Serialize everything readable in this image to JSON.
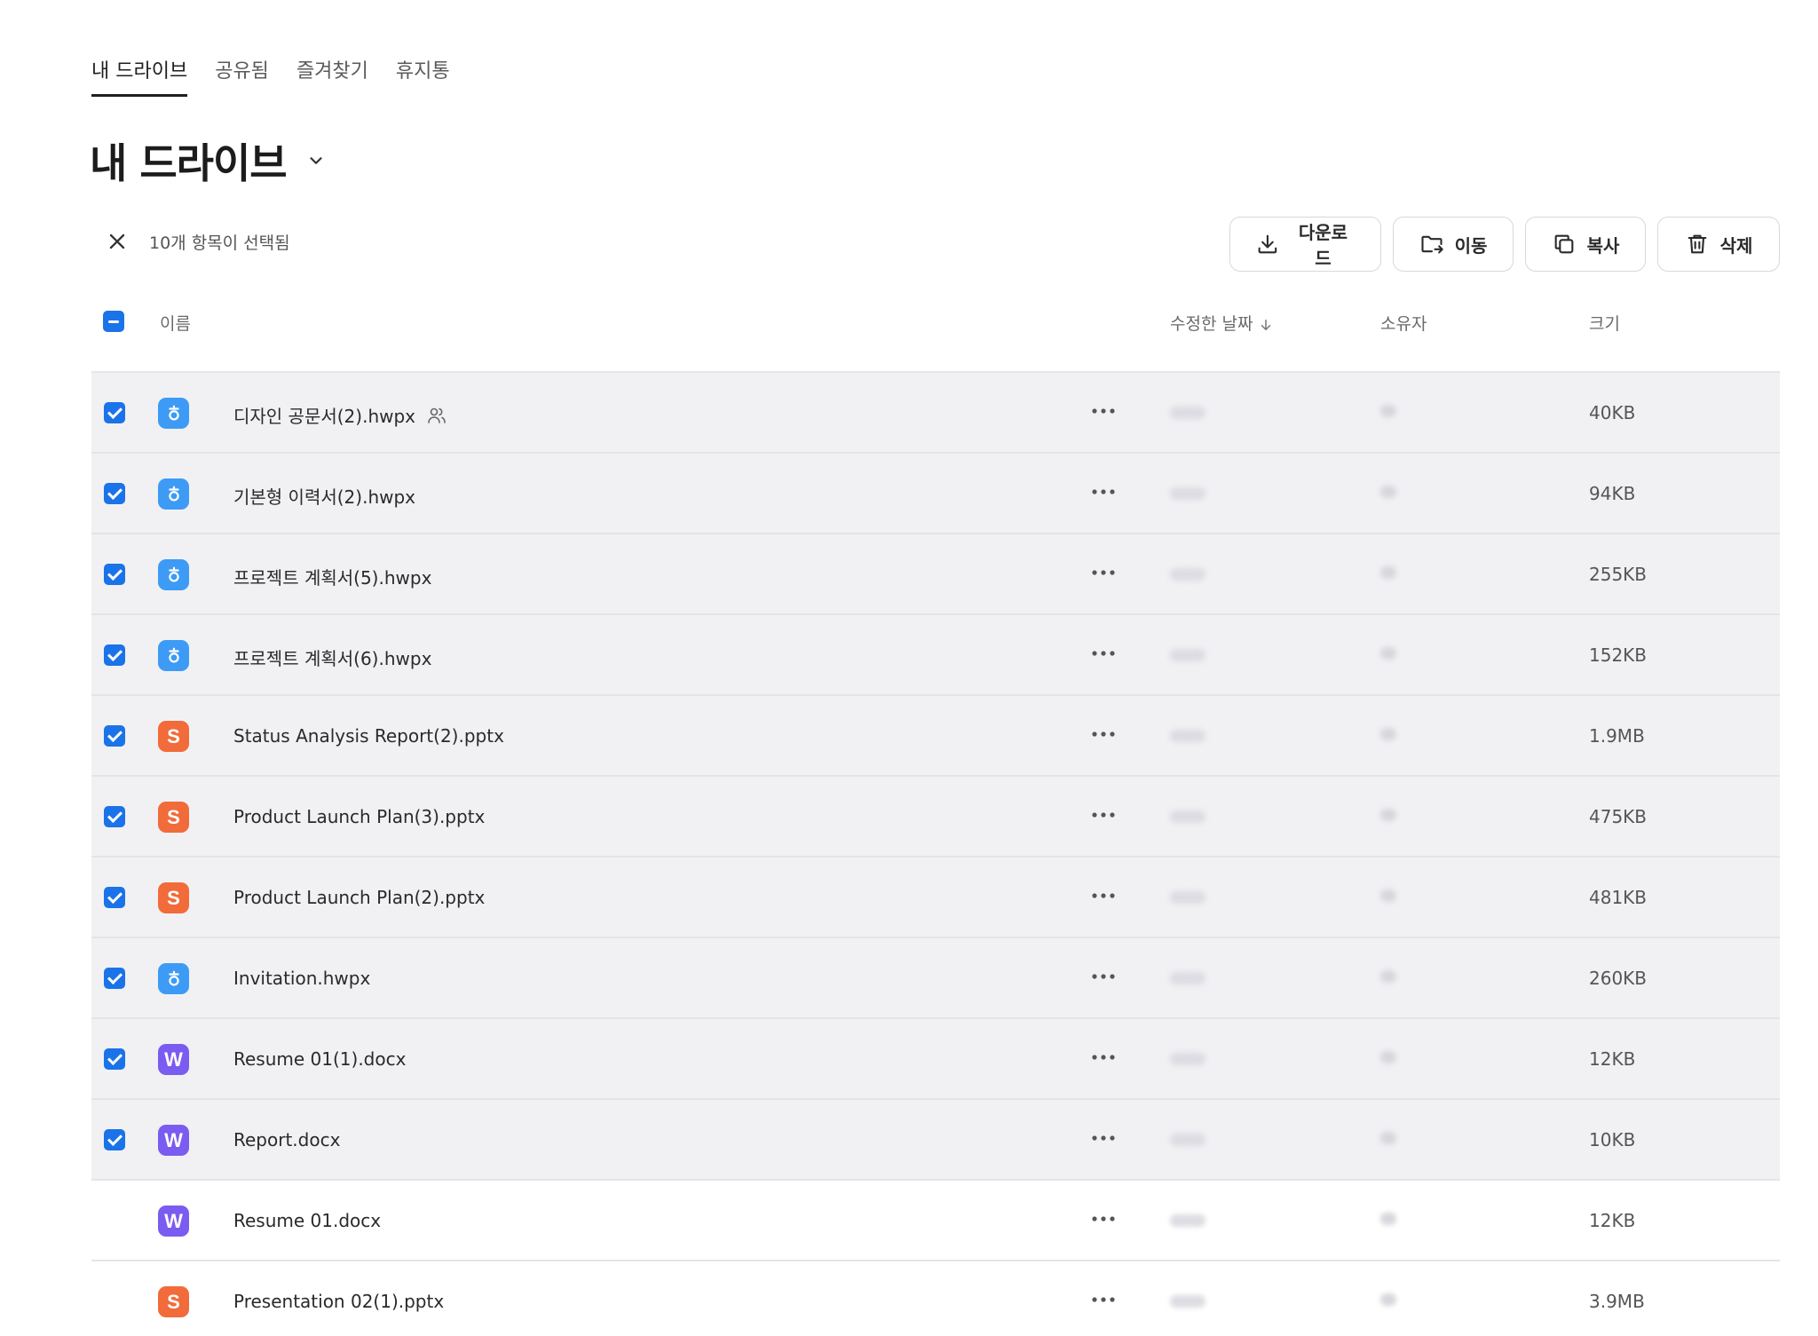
{
  "tabs": [
    {
      "label": "내 드라이브",
      "active": true
    },
    {
      "label": "공유됨",
      "active": false
    },
    {
      "label": "즐겨찾기",
      "active": false
    },
    {
      "label": "휴지통",
      "active": false
    }
  ],
  "page_title": "내 드라이브",
  "selection": {
    "text": "10개 항목이 선택됨"
  },
  "actions": {
    "download": "다운로드",
    "move": "이동",
    "copy": "복사",
    "delete": "삭제"
  },
  "columns": {
    "name": "이름",
    "modified": "수정한 날짜",
    "owner": "소유자",
    "size": "크기"
  },
  "colors": {
    "accent": "#1a73e8",
    "hwp_icon": "#3d9bf5",
    "pptx_icon": "#f26b3a",
    "docx_icon": "#7b5cf0",
    "selected_row_bg": "#f1f1f4"
  },
  "files": [
    {
      "name": "디자인 공문서(2).hwpx",
      "type": "hwp",
      "icon_letter": "",
      "size": "40KB",
      "selected": true,
      "shared": true
    },
    {
      "name": "기본형 이력서(2).hwpx",
      "type": "hwp",
      "icon_letter": "",
      "size": "94KB",
      "selected": true,
      "shared": false
    },
    {
      "name": "프로젝트 계획서(5).hwpx",
      "type": "hwp",
      "icon_letter": "",
      "size": "255KB",
      "selected": true,
      "shared": false
    },
    {
      "name": "프로젝트 계획서(6).hwpx",
      "type": "hwp",
      "icon_letter": "",
      "size": "152KB",
      "selected": true,
      "shared": false
    },
    {
      "name": "Status Analysis Report(2).pptx",
      "type": "ppt",
      "icon_letter": "S",
      "size": "1.9MB",
      "selected": true,
      "shared": false
    },
    {
      "name": "Product Launch Plan(3).pptx",
      "type": "ppt",
      "icon_letter": "S",
      "size": "475KB",
      "selected": true,
      "shared": false
    },
    {
      "name": "Product Launch Plan(2).pptx",
      "type": "ppt",
      "icon_letter": "S",
      "size": "481KB",
      "selected": true,
      "shared": false
    },
    {
      "name": "Invitation.hwpx",
      "type": "hwp",
      "icon_letter": "",
      "size": "260KB",
      "selected": true,
      "shared": false
    },
    {
      "name": "Resume 01(1).docx",
      "type": "doc",
      "icon_letter": "W",
      "size": "12KB",
      "selected": true,
      "shared": false
    },
    {
      "name": "Report.docx",
      "type": "doc",
      "icon_letter": "W",
      "size": "10KB",
      "selected": true,
      "shared": false
    },
    {
      "name": "Resume 01.docx",
      "type": "doc",
      "icon_letter": "W",
      "size": "12KB",
      "selected": false,
      "shared": false
    },
    {
      "name": "Presentation 02(1).pptx",
      "type": "ppt",
      "icon_letter": "S",
      "size": "3.9MB",
      "selected": false,
      "shared": false
    }
  ]
}
